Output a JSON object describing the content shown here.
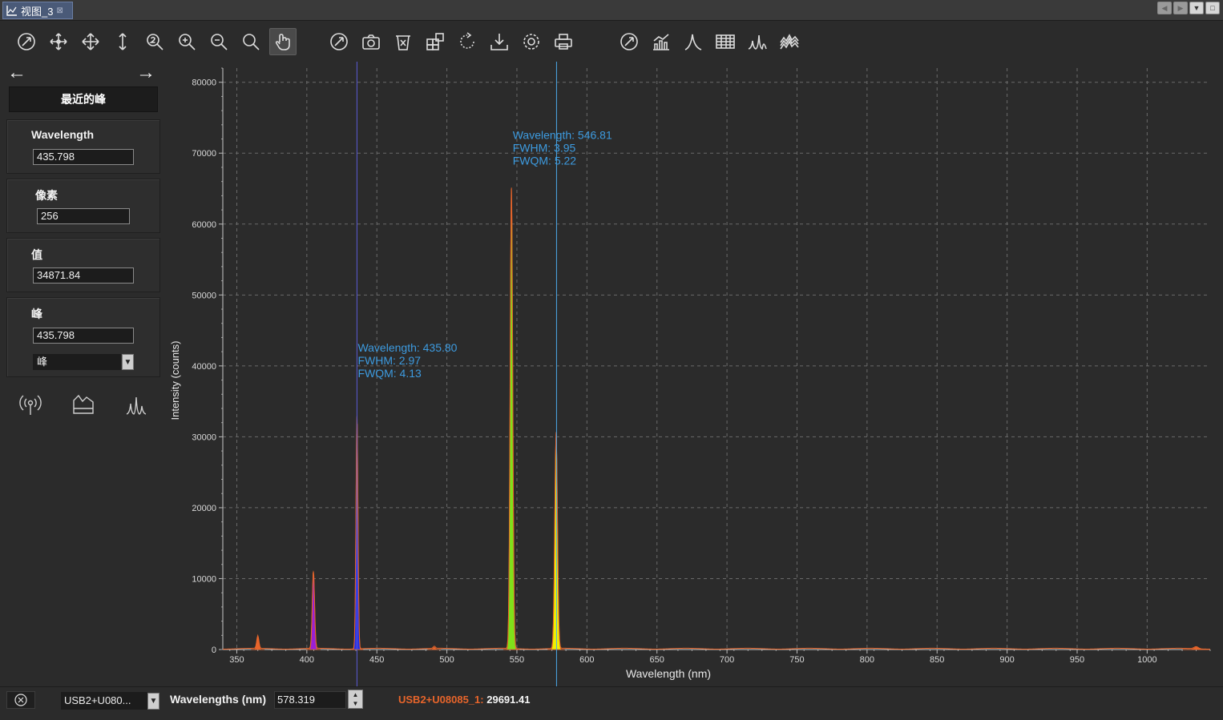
{
  "window": {
    "tab_title": "视图_3"
  },
  "toolbar": {
    "groups": [
      [
        "zoom-reset",
        "pan",
        "move",
        "vertical-scale",
        "zoom-2x",
        "zoom-in",
        "zoom-out",
        "zoom-fit",
        "hand-select"
      ],
      [
        "auto-scale",
        "snapshot",
        "clear",
        "export-grid",
        "refresh",
        "save",
        "settings",
        "print"
      ],
      [
        "auto-range",
        "overlay-chart",
        "peak-marker",
        "data-table",
        "peak-find",
        "waterfall"
      ]
    ]
  },
  "left_panel": {
    "title": "最近的峰",
    "wavelength_label": "Wavelength",
    "wavelength_value": "435.798",
    "pixel_label": "像素",
    "pixel_value": "256",
    "value_label": "值",
    "value_value": "34871.84",
    "peak_label": "峰",
    "peak_value": "435.798",
    "peak_mode": "峰"
  },
  "status_bar": {
    "device": "USB2+U080...",
    "wavelengths_label": "Wavelengths (nm)",
    "wavelengths_value": "578.319",
    "reading_device": "USB2+U08085_1:",
    "reading_value": "29691.41"
  },
  "chart_data": {
    "type": "line",
    "xlabel": "Wavelength (nm)",
    "ylabel": "Intensity (counts)",
    "xlim": [
      340,
      1045
    ],
    "ylim": [
      0,
      82000
    ],
    "x_ticks": [
      350,
      400,
      450,
      500,
      550,
      600,
      650,
      700,
      750,
      800,
      850,
      900,
      950,
      1000
    ],
    "y_ticks": [
      0,
      10000,
      20000,
      30000,
      40000,
      50000,
      60000,
      70000,
      80000
    ],
    "y_tick_labels": [
      "0",
      "10000",
      "20000",
      "30000",
      "40000",
      "50000",
      "60000",
      "70000",
      "80000"
    ],
    "grid": true,
    "line_color": "#e8652b",
    "peaks": [
      {
        "center": 365.0,
        "height": 1800,
        "width": 1.5,
        "fill": "#e8652b"
      },
      {
        "center": 404.7,
        "height": 11000,
        "width": 1.6,
        "fill": "#9a1fd6"
      },
      {
        "center": 435.8,
        "height": 33000,
        "width": 1.4,
        "fill": "#2530e8"
      },
      {
        "center": 546.1,
        "height": 65200,
        "width": 1.8,
        "fill": "#7fe01a"
      },
      {
        "center": 578.0,
        "height": 30500,
        "width": 1.9,
        "fill": "#f0f000"
      },
      {
        "center": 491.0,
        "height": 300,
        "width": 1.5,
        "fill": "#e8652b"
      },
      {
        "center": 1035.0,
        "height": 300,
        "width": 3,
        "fill": "#e8652b"
      }
    ],
    "markers": [
      {
        "x": 435.8,
        "color": "#5a5ad6"
      },
      {
        "x": 578.3,
        "color": "#4aa6e6"
      }
    ],
    "annotations": [
      {
        "x": 436.4,
        "y": 42000,
        "lines": [
          "Wavelength: 435.80",
          "FWHM: 2.97",
          "FWQM: 4.13"
        ]
      },
      {
        "x": 547.0,
        "y": 72000,
        "lines": [
          "Wavelength: 546.81",
          "FWHM: 3.95",
          "FWQM: 5.22"
        ]
      }
    ],
    "annotation_color": "#3d9be0"
  }
}
